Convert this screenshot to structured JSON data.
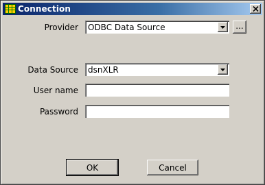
{
  "window": {
    "title": "Connection",
    "icon": "grid-app-icon",
    "close_glyph": "✕"
  },
  "form": {
    "provider": {
      "label": "Provider",
      "value": "ODBC Data Source",
      "browse_label": "..."
    },
    "data_source": {
      "label": "Data Source",
      "value": "dsnXLR"
    },
    "user_name": {
      "label": "User name",
      "value": ""
    },
    "password": {
      "label": "Password",
      "value": ""
    }
  },
  "buttons": {
    "ok_label": "OK",
    "cancel_label": "Cancel"
  },
  "colors": {
    "title_bar": "#0a246a",
    "dialog_face": "#d4d0c8",
    "icon_fill": "#ffcc00",
    "icon_grid": "#008000"
  }
}
